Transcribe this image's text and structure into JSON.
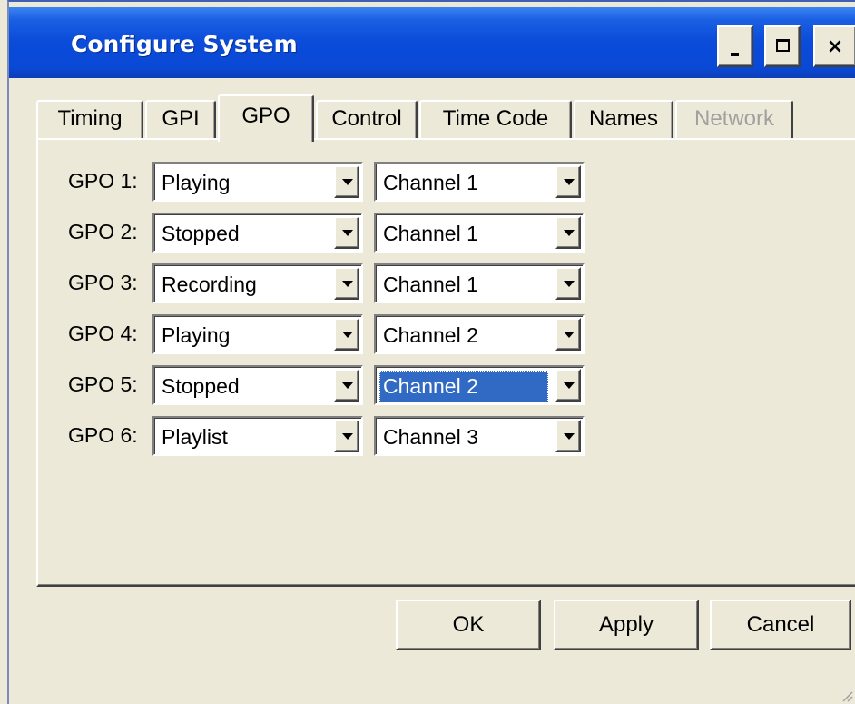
{
  "window": {
    "title": "Configure System",
    "controls": {
      "minimize_icon": "minimize-icon",
      "maximize_icon": "maximize-icon",
      "close_icon": "close-icon",
      "close_glyph": "×"
    }
  },
  "tabs": [
    {
      "label": "Timing",
      "state": "normal"
    },
    {
      "label": "GPI",
      "state": "normal"
    },
    {
      "label": "GPO",
      "state": "active"
    },
    {
      "label": "Control",
      "state": "normal"
    },
    {
      "label": "Time Code",
      "state": "normal"
    },
    {
      "label": "Names",
      "state": "normal"
    },
    {
      "label": "Network",
      "state": "disabled"
    }
  ],
  "gpo_rows": [
    {
      "label": "GPO 1:",
      "state": "Playing",
      "channel": "Channel 1"
    },
    {
      "label": "GPO 2:",
      "state": "Stopped",
      "channel": "Channel 1"
    },
    {
      "label": "GPO 3:",
      "state": "Recording",
      "channel": "Channel 1"
    },
    {
      "label": "GPO 4:",
      "state": "Playing",
      "channel": "Channel 2"
    },
    {
      "label": "GPO 5:",
      "state": "Stopped",
      "channel": "Channel 2"
    },
    {
      "label": "GPO 6:",
      "state": "Playlist",
      "channel": "Channel 3"
    }
  ],
  "focused_field": "GPO 5 channel",
  "buttons": {
    "ok": "OK",
    "apply": "Apply",
    "cancel": "Cancel"
  },
  "colors": {
    "title_bar": "#0a4bd9",
    "face": "#ece9d8",
    "selection": "#316ac5"
  }
}
